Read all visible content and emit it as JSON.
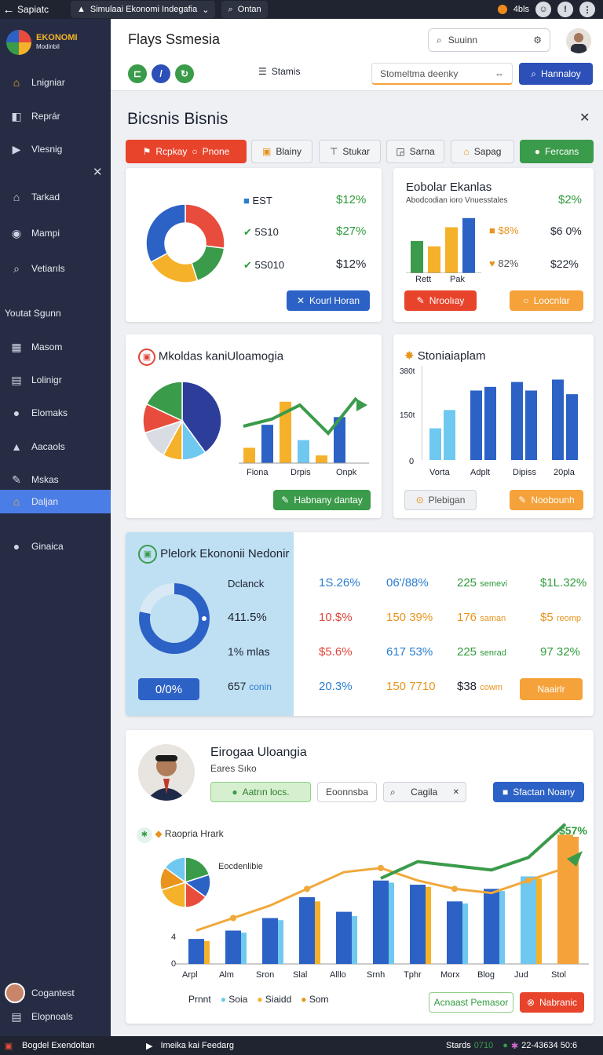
{
  "topbar": {
    "app_name": "Sapiatc",
    "tab_label": "Simulaai Ekonomi Indegafia",
    "search_label": "Ontan",
    "counter": "4bls"
  },
  "sidebar": {
    "logo_title": "EKONOMI",
    "logo_sub": "Modinbil",
    "items": [
      {
        "label": "Lnigniar"
      },
      {
        "label": "Reprár"
      },
      {
        "label": "Vlesnig"
      },
      {
        "label": "Tarkad"
      },
      {
        "label": "Mampi"
      },
      {
        "label": "Vetiarıls"
      }
    ],
    "section_label": "Youtat Sgunn",
    "items2": [
      {
        "label": "Masom"
      },
      {
        "label": "Lolinigr"
      },
      {
        "label": "Elomaks"
      },
      {
        "label": "Aacaols"
      },
      {
        "label": "Mskas"
      },
      {
        "label": "Daljan"
      },
      {
        "label": "Ginaica"
      }
    ],
    "user_label": "Cogantest",
    "footer_label": "Elopnoals"
  },
  "bottombar": {
    "left_label": "Bogdel Exendoltan",
    "mid_label": "Imeika kai Feedarg",
    "status_label": "Stards",
    "status_value": "0710",
    "clock": "22-43634 50:6"
  },
  "header": {
    "title": "Flays Ssmesia",
    "search_placeholder": "Suuinn",
    "status_label": "Stamis",
    "select_value": "Stomeltma deenky",
    "primary_label": "Hannaloy"
  },
  "panel": {
    "title": "Bicsnis Bisnis",
    "chips": [
      {
        "label": "Rcpkay"
      },
      {
        "label": "Pnone"
      },
      {
        "label": "Blainy"
      },
      {
        "label": "Stukar"
      },
      {
        "label": "Sarna"
      },
      {
        "label": "Sapag"
      },
      {
        "label": "Fercans"
      }
    ]
  },
  "card1": {
    "rows": [
      {
        "code": "EST",
        "value": "$12%"
      },
      {
        "code": "5S10",
        "value": "$27%"
      },
      {
        "code": "5S010",
        "value": "$12%"
      }
    ],
    "button": "Kourl Horan",
    "donut": {
      "segments": [
        {
          "name": "red",
          "value": 0.27,
          "color": "#e74c3c"
        },
        {
          "name": "green",
          "value": 0.18,
          "color": "#3a9b4a"
        },
        {
          "name": "orange",
          "value": 0.22,
          "color": "#f5b12a"
        },
        {
          "name": "blue",
          "value": 0.33,
          "color": "#2c62c6"
        }
      ]
    }
  },
  "card2": {
    "title": "Eobolar Ekanlas",
    "subtitle": "Abodcodian ioro Vnuesstales",
    "headline": "$2%",
    "stats": [
      {
        "pct": "$8%",
        "val": "$6 0%"
      },
      {
        "pct": "82%",
        "val": "$22%"
      }
    ],
    "xlabels": [
      "Rett",
      "Pak"
    ],
    "btn_a": "Nroolıay",
    "btn_b": "Loocnlar",
    "chart_data": {
      "type": "bar",
      "categories": [
        "Rett",
        "",
        "Pak",
        ""
      ],
      "values": [
        42,
        35,
        60,
        72
      ],
      "colors": [
        "#3a9b4a",
        "#f5b12a",
        "#f5b12a",
        "#2c62c6"
      ]
    }
  },
  "card3": {
    "title": "Mkoldas kaniUloamogia",
    "xlabels": [
      "Fiona",
      "Drpis",
      "Onpk"
    ],
    "button": "Habnany dantay",
    "pie": {
      "segments": [
        {
          "value": 0.4,
          "color": "#2c3e99"
        },
        {
          "value": 0.1,
          "color": "#6fc8f0"
        },
        {
          "value": 0.08,
          "color": "#f5b12a"
        },
        {
          "value": 0.12,
          "color": "#d9dde3"
        },
        {
          "value": 0.12,
          "color": "#e74c3c"
        },
        {
          "value": 0.18,
          "color": "#3a9b4a"
        }
      ]
    },
    "chart_data": {
      "type": "bar",
      "series": [
        {
          "name": "",
          "values": [
            2,
            5,
            8,
            3,
            1,
            6
          ]
        }
      ],
      "line": [
        3,
        4,
        6,
        2,
        7
      ],
      "colors": [
        "#f5b12a",
        "#2c62c6",
        "#f5b12a",
        "#6fc8f0",
        "#f5b12a",
        "#2c62c6"
      ]
    }
  },
  "card4": {
    "title": "Stoniaiaplam",
    "yticks": [
      "380t",
      "150t",
      "0"
    ],
    "xlabels": [
      "Vorta",
      "Adplt",
      "Dipiss",
      "20pla"
    ],
    "btn_a": "Plebigan",
    "btn_b": "Noobounh",
    "chart_data": {
      "type": "bar",
      "ylim": [
        0,
        380
      ],
      "values": [
        130,
        205,
        285,
        300,
        320,
        285,
        330,
        270,
        350,
        320
      ],
      "colors": [
        "#6fc8f0",
        "#6fc8f0",
        "#2c62c6",
        "#2c62c6",
        "#2c62c6",
        "#2c62c6",
        "#2c62c6",
        "#2c62c6",
        "#6fc8f0",
        "#6fc8f0"
      ]
    }
  },
  "card5": {
    "title": "Plelork Ekononii Nedonir",
    "badge": "0/0%",
    "gauge_value": 0.78,
    "cells": [
      [
        "Dclanck",
        "1S.26%",
        "06'/88%",
        "225",
        "semevi",
        "$1L.32%"
      ],
      [
        "411.5%",
        "10.$%",
        "150 39%",
        "176",
        "saman",
        "$5",
        "reomp"
      ],
      [
        "1% mlas",
        "$5.6%",
        "617 53%",
        "225",
        "senrad",
        "97 32%"
      ],
      [
        "657",
        "conin",
        "20.3%",
        "150 7710",
        "$38",
        "cowm"
      ]
    ],
    "button": "Naairlr"
  },
  "card6": {
    "title": "Eirogaa Uloangia",
    "subtitle": "Eares Sıko",
    "chip_a": "Aatrın locs.",
    "chip_b": "Eoonnsba",
    "search": "Cagila",
    "primary": "Sfactan Noany",
    "chart_title": "Raopria Hrark",
    "inset_label": "Eocdenlibie",
    "badge": "$57%",
    "yticks": [
      "4",
      "0"
    ],
    "legend": [
      {
        "label": "Prnnt"
      },
      {
        "label": "Soia"
      },
      {
        "label": "Siaidd"
      },
      {
        "label": "Som"
      }
    ],
    "btn_a": "Acnaast Pemasor",
    "btn_b": "Nabranic",
    "chart_data": {
      "type": "bar",
      "categories": [
        "Arpl",
        "Alm",
        "Sron",
        "Slal",
        "Alllo",
        "Srnh",
        "Tphr",
        "Morx",
        "Blog",
        "Jud",
        "Stol"
      ],
      "series": [
        {
          "name": "",
          "values": [
            12,
            16,
            22,
            32,
            25,
            40,
            38,
            30,
            36,
            42,
            62
          ]
        },
        {
          "name": "",
          "values": [
            11,
            15,
            21,
            30,
            23,
            39,
            37,
            29,
            35,
            41,
            61
          ]
        }
      ],
      "line_orange": [
        10,
        16,
        22,
        30,
        38,
        40,
        34,
        30,
        28,
        34,
        40
      ],
      "line_green": [
        null,
        null,
        null,
        null,
        null,
        26,
        34,
        32,
        30,
        36,
        52
      ]
    }
  }
}
